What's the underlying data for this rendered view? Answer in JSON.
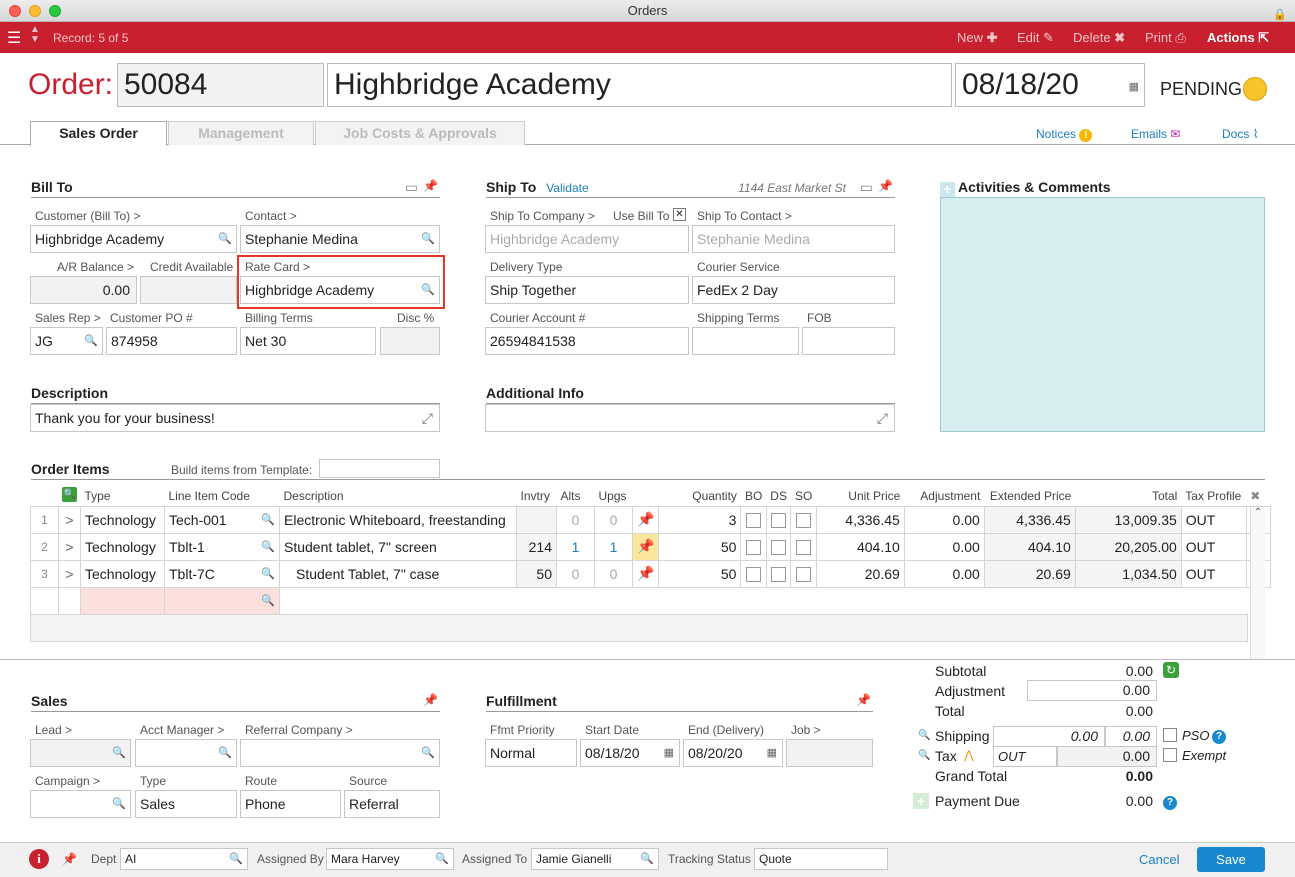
{
  "window": {
    "title": "Orders"
  },
  "toolbar": {
    "record": "Record: 5 of 5",
    "new": "New",
    "edit": "Edit",
    "delete": "Delete",
    "print": "Print",
    "actions": "Actions"
  },
  "header": {
    "order_label": "Order:",
    "order_number": "50084",
    "customer": "Highbridge Academy",
    "date": "08/18/20",
    "status": "PENDING",
    "status_color": "#f7c52b"
  },
  "tabs": [
    {
      "label": "Sales Order"
    },
    {
      "label": "Management"
    },
    {
      "label": "Job Costs & Approvals"
    }
  ],
  "toplinks": {
    "notices": "Notices",
    "emails": "Emails",
    "docs": "Docs"
  },
  "bill_to": {
    "title": "Bill To",
    "customer_label": "Customer (Bill To) >",
    "customer": "Highbridge Academy",
    "contact_label": "Contact >",
    "contact": "Stephanie Medina",
    "ar_label": "A/R Balance >",
    "ar": "0.00",
    "credit_label": "Credit Available",
    "credit": "",
    "rate_label": "Rate Card >",
    "rate": "Highbridge Academy",
    "rep_label": "Sales Rep >",
    "rep": "JG",
    "po_label": "Customer PO #",
    "po": "874958",
    "terms_label": "Billing Terms",
    "terms": "Net 30",
    "disc_label": "Disc %",
    "disc": ""
  },
  "ship_to": {
    "title": "Ship To",
    "validate": "Validate",
    "address": "1144 East Market St",
    "company_label": "Ship To Company >",
    "use_bill_label": "Use Bill To",
    "company": "Highbridge Academy",
    "contact_label": "Ship To Contact >",
    "contact": "Stephanie Medina",
    "delivery_label": "Delivery Type",
    "delivery": "Ship Together",
    "courier_label": "Courier Service",
    "courier": "FedEx 2 Day",
    "account_label": "Courier Account #",
    "account": "26594841538",
    "shipping_terms_label": "Shipping Terms",
    "shipping_terms": "",
    "fob_label": "FOB",
    "fob": ""
  },
  "activities": {
    "title": "Activities & Comments"
  },
  "description": {
    "title": "Description",
    "value": "Thank you for your business!"
  },
  "additional": {
    "title": "Additional Info",
    "value": ""
  },
  "order_items": {
    "title": "Order Items",
    "template_label": "Build items from Template:",
    "columns": [
      "Type",
      "Line Item Code",
      "Description",
      "Invtry",
      "Alts",
      "Upgs",
      "Quantity",
      "BO",
      "DS",
      "SO",
      "Unit Price",
      "Adjustment",
      "Extended Price",
      "Total",
      "Tax Profile"
    ],
    "rows": [
      {
        "num": "1",
        "type": "Technology",
        "code": "Tech-001",
        "desc": "Electronic Whiteboard, freestanding",
        "inv": "",
        "alts": "0",
        "upgs": "0",
        "qty": "3",
        "unit": "4,336.45",
        "adj": "0.00",
        "ext": "4,336.45",
        "total": "13,009.35",
        "tax": "OUT"
      },
      {
        "num": "2",
        "type": "Technology",
        "code": "Tblt-1",
        "desc": "Student tablet, 7\" screen",
        "inv": "214",
        "alts": "1",
        "upgs": "1",
        "qty": "50",
        "unit": "404.10",
        "adj": "0.00",
        "ext": "404.10",
        "total": "20,205.00",
        "tax": "OUT"
      },
      {
        "num": "3",
        "type": "Technology",
        "code": "Tblt-7C",
        "desc": "Student Tablet, 7\" case",
        "inv": "50",
        "alts": "0",
        "upgs": "0",
        "qty": "50",
        "unit": "20.69",
        "adj": "0.00",
        "ext": "20.69",
        "total": "1,034.50",
        "tax": "OUT"
      }
    ]
  },
  "sales": {
    "title": "Sales",
    "lead_label": "Lead >",
    "lead": "",
    "acct_label": "Acct Manager >",
    "acct": "",
    "referral_label": "Referral Company >",
    "referral": "",
    "campaign_label": "Campaign >",
    "campaign": "",
    "type_label": "Type",
    "type": "Sales",
    "route_label": "Route",
    "route": "Phone",
    "source_label": "Source",
    "source": "Referral"
  },
  "fulfillment": {
    "title": "Fulfillment",
    "priority_label": "Ffmt Priority",
    "priority": "Normal",
    "start_label": "Start Date",
    "start": "08/18/20",
    "end_label": "End (Delivery)",
    "end": "08/20/20",
    "job_label": "Job >",
    "job": ""
  },
  "totals": {
    "subtotal_label": "Subtotal",
    "subtotal": "0.00",
    "adjustment_label": "Adjustment",
    "adjustment": "0.00",
    "total_label": "Total",
    "total": "0.00",
    "shipping_label": "Shipping",
    "shipping_a": "0.00",
    "shipping_b": "0.00",
    "pso_label": "PSO",
    "tax_label": "Tax",
    "tax_profile": "OUT",
    "tax": "0.00",
    "exempt_label": "Exempt",
    "grand_label": "Grand Total",
    "grand": "0.00",
    "payment_label": "Payment Due",
    "payment": "0.00"
  },
  "bottom": {
    "dept_label": "Dept",
    "dept": "AI",
    "assigned_by_label": "Assigned By",
    "assigned_by": "Mara Harvey",
    "assigned_to_label": "Assigned To",
    "assigned_to": "Jamie Gianelli",
    "tracking_label": "Tracking Status",
    "tracking": "Quote",
    "cancel": "Cancel",
    "save": "Save"
  }
}
